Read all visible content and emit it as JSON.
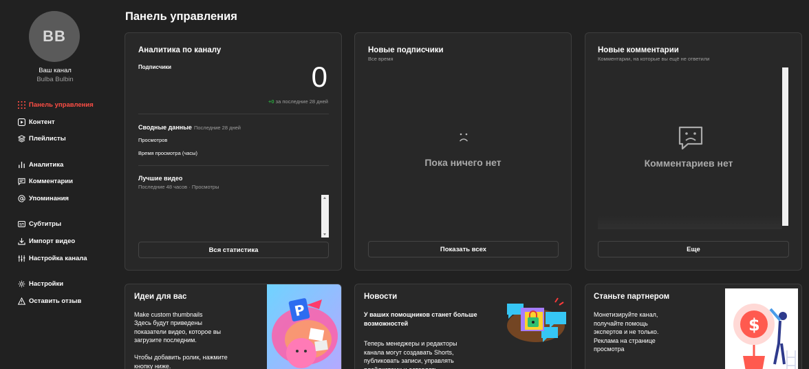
{
  "channel": {
    "initials": "BB",
    "label": "Ваш канал",
    "name": "Bulba Bulbin"
  },
  "nav": {
    "dashboard": "Панель управления",
    "content": "Контент",
    "playlists": "Плейлисты",
    "analytics": "Аналитика",
    "comments": "Комментарии",
    "mentions": "Упоминания",
    "subtitles": "Субтитры",
    "import": "Импорт видео",
    "customization": "Настройка канала",
    "settings": "Настройки",
    "feedback": "Оставить отзыв"
  },
  "page": {
    "title": "Панель управления"
  },
  "analytics": {
    "title": "Аналитика по каналу",
    "subscribers_label": "Подписчики",
    "subscribers_value": "0",
    "delta": "+0",
    "delta_period": "за последние 28 дней",
    "summary_title": "Сводные данные",
    "summary_period": "Последние 28 дней",
    "views_label": "Просмотров",
    "watch_time_label": "Время просмотра (часы)",
    "top_title": "Лучшие видео",
    "top_sub": "Последние 48 часов · Просмотры",
    "button": "Вся статистика"
  },
  "subscribers": {
    "title": "Новые подписчики",
    "sub": "Все время",
    "empty": "Пока ничего нет",
    "button": "Показать всех"
  },
  "comments": {
    "title": "Новые комментарии",
    "sub": "Комментарии, на которые вы ещё не ответили",
    "empty": "Комментариев нет",
    "button": "Еще"
  },
  "ideas": {
    "title": "Идеи для вас",
    "line1": "Make custom thumbnails",
    "line2": "Здесь будут приведены показатели видео, которое вы загрузите последним.",
    "line3": "Чтобы добавить ролик, нажмите кнопку ниже."
  },
  "news": {
    "title": "Новости",
    "headline": "У ваших помощников станет больше возможностей",
    "body": "Теперь менеджеры и редакторы канала могут создавать Shorts, публиковать записи, управлять плейлистами и оставлять"
  },
  "partner": {
    "title": "Станьте партнером",
    "body": "Монетизируйте канал, получайте помощь экспертов и не только. Реклама на странице просмотра"
  },
  "colors": {
    "accent": "#ff4e45",
    "positive": "#2ba640",
    "background": "#212121",
    "card": "#282828"
  }
}
